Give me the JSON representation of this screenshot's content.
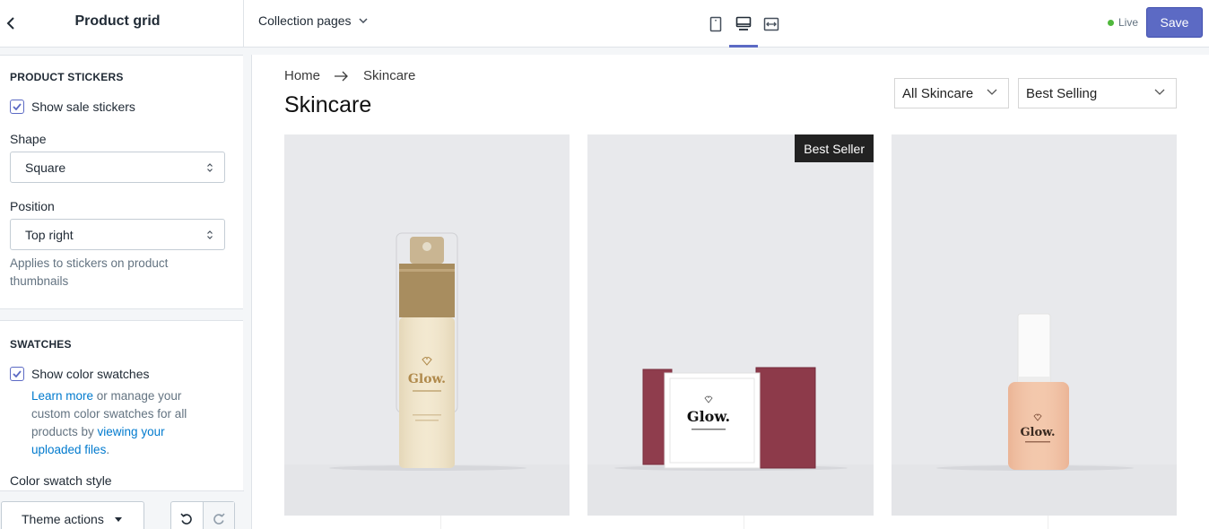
{
  "header": {
    "panel_title": "Product grid",
    "page_selector": "Collection pages",
    "status": "Live",
    "save_label": "Save",
    "accent_color": "#5c6ac4",
    "devices": [
      "mobile-icon",
      "desktop-icon",
      "fullscreen-icon"
    ],
    "active_device": "desktop"
  },
  "sidebar": {
    "product_stickers": {
      "heading": "PRODUCT STICKERS",
      "show_sale_stickers_label": "Show sale stickers",
      "show_sale_stickers_checked": true,
      "shape_label": "Shape",
      "shape_value": "Square",
      "position_label": "Position",
      "position_value": "Top right",
      "help_text": "Applies to stickers on product thumbnails"
    },
    "swatches": {
      "heading": "SWATCHES",
      "show_color_swatches_label": "Show color swatches",
      "show_color_swatches_checked": true,
      "help_link_1": "Learn more",
      "help_text_1": " or manage your custom color swatches for all products by ",
      "help_link_2": "viewing your uploaded files",
      "help_text_2": ".",
      "color_swatch_style_label": "Color swatch style"
    },
    "footer": {
      "theme_actions_label": "Theme actions"
    }
  },
  "preview": {
    "breadcrumb": [
      "Home",
      "Skincare"
    ],
    "title": "Skincare",
    "filter_value": "All Skincare",
    "sort_value": "Best Selling",
    "products": [
      {
        "image": "spray-bottle",
        "badge": ""
      },
      {
        "image": "soap-bar-box",
        "badge": "Best Seller"
      },
      {
        "image": "serum-bottle",
        "badge": ""
      }
    ],
    "brand_text": "Glow."
  }
}
